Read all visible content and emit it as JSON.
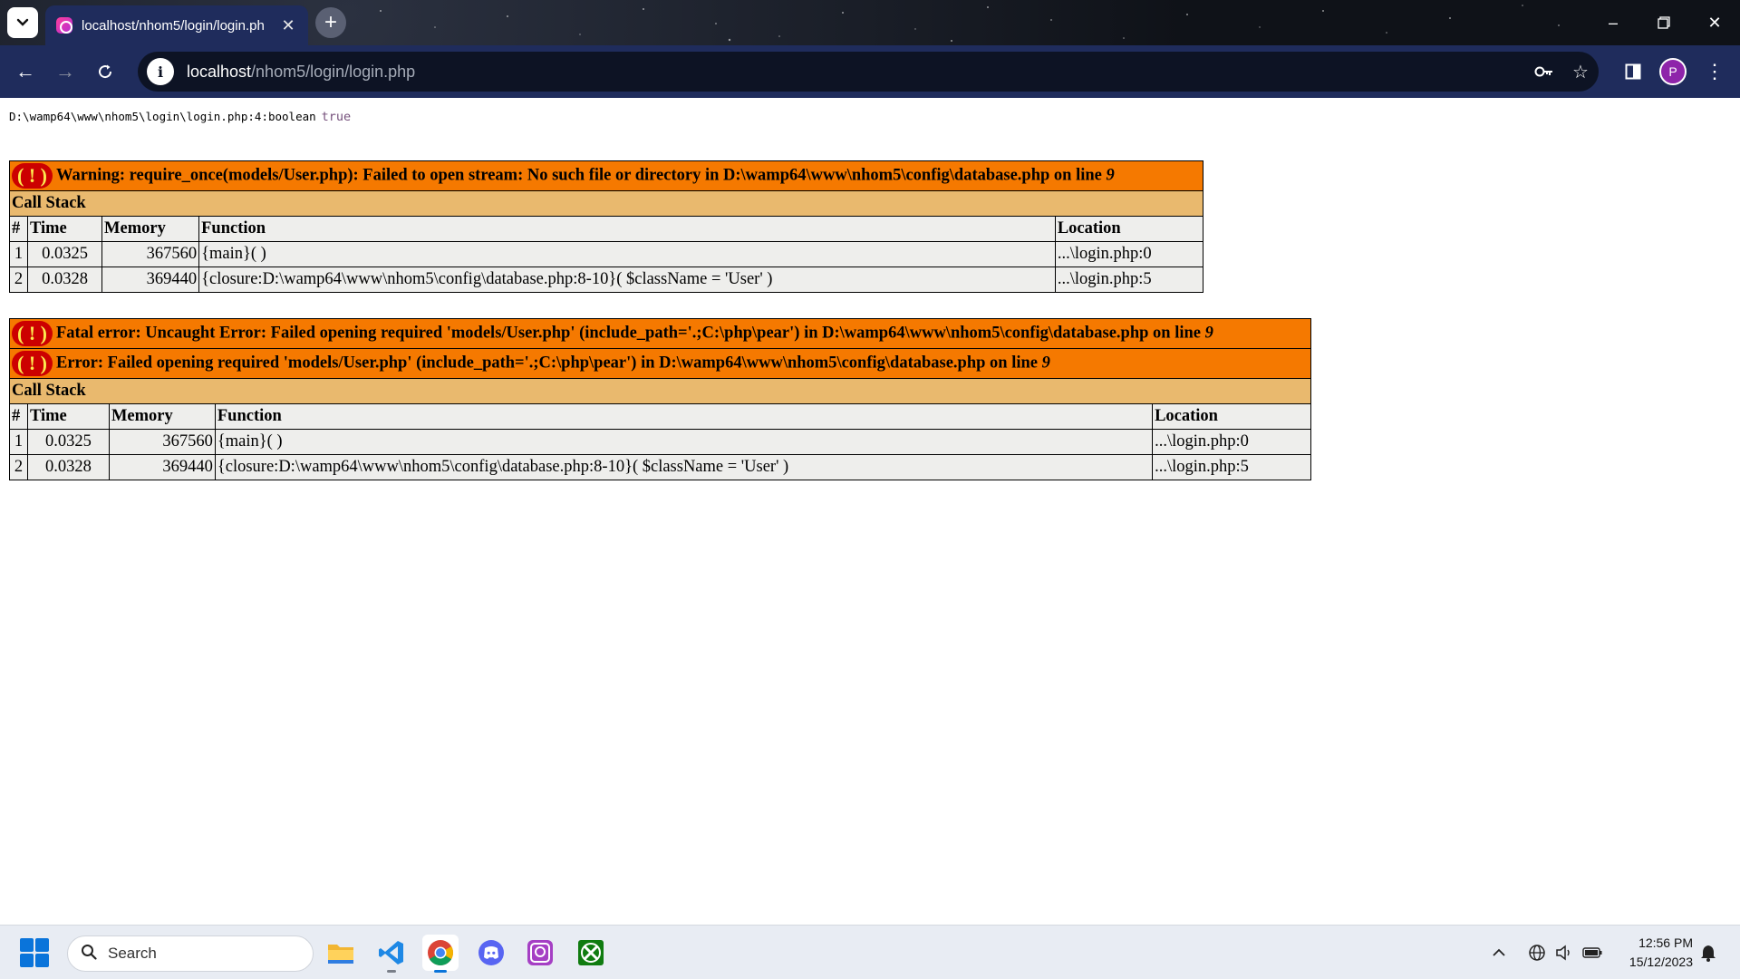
{
  "browser": {
    "tab": {
      "title": "localhost/nhom5/login/login.ph",
      "favicon": "php-app-icon"
    },
    "omnibox": {
      "host": "localhost",
      "path": "/nhom5/login/login.php"
    },
    "profile_initial": "P"
  },
  "page": {
    "var_dump": {
      "location": "D:\\wamp64\\www\\nhom5\\login\\login.php:4:boolean",
      "value": "true"
    },
    "warning": {
      "message": "Warning: require_once(models/User.php): Failed to open stream: No such file or directory in D:\\wamp64\\www\\nhom5\\config\\database.php on line",
      "line": "9",
      "call_stack_label": "Call Stack",
      "headers": [
        "#",
        "Time",
        "Memory",
        "Function",
        "Location"
      ],
      "rows": [
        {
          "n": "1",
          "time": "0.0325",
          "memory": "367560",
          "func": "{main}( )",
          "loc": "...\\login.php:0"
        },
        {
          "n": "2",
          "time": "0.0328",
          "memory": "369440",
          "func": "{closure:D:\\wamp64\\www\\nhom5\\config\\database.php:8-10}( $className = 'User' )",
          "loc": "...\\login.php:5"
        }
      ]
    },
    "fatal": {
      "message": "Fatal error: Uncaught Error: Failed opening required 'models/User.php' (include_path='.;C:\\php\\pear') in D:\\wamp64\\www\\nhom5\\config\\database.php on line",
      "line": "9",
      "error_message": "Error: Failed opening required 'models/User.php' (include_path='.;C:\\php\\pear') in D:\\wamp64\\www\\nhom5\\config\\database.php on line",
      "error_line": "9",
      "call_stack_label": "Call Stack",
      "headers": [
        "#",
        "Time",
        "Memory",
        "Function",
        "Location"
      ],
      "rows": [
        {
          "n": "1",
          "time": "0.0325",
          "memory": "367560",
          "func": "{main}( )",
          "loc": "...\\login.php:0"
        },
        {
          "n": "2",
          "time": "0.0328",
          "memory": "369440",
          "func": "{closure:D:\\wamp64\\www\\nhom5\\config\\database.php:8-10}( $className = 'User' )",
          "loc": "...\\login.php:5"
        }
      ]
    }
  },
  "taskbar": {
    "search_placeholder": "Search",
    "apps": [
      "file-explorer-icon",
      "vscode-icon",
      "chrome-icon",
      "discord-icon",
      "php-app-icon",
      "xbox-icon"
    ],
    "time": "12:56 PM",
    "date": "15/12/2023"
  },
  "colors": {
    "error_header": "#f57900",
    "call_stack_bg": "#e9b96e",
    "row_bg": "#eeeeec",
    "bang_bg": "#cc0000",
    "bang_fg": "#fce94f",
    "chrome_toolbar": "#1f2c5c"
  }
}
